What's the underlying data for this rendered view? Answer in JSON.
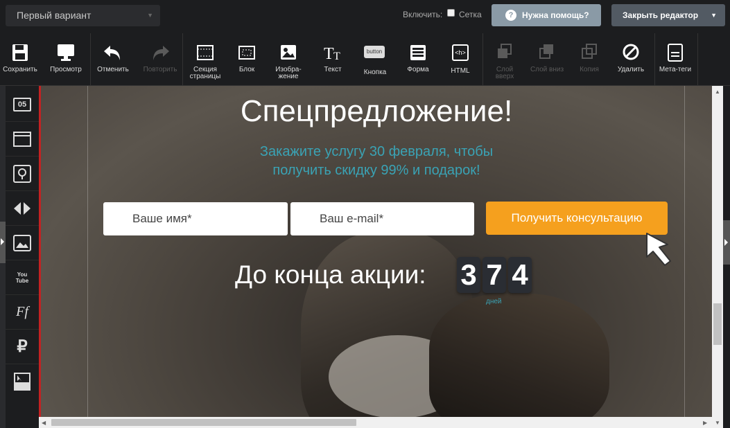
{
  "topbar": {
    "variant": "Первый вариант",
    "enable_label": "Включить:",
    "grid_label": "Сетка",
    "help_label": "Нужна помощь?",
    "close_label": "Закрыть редактор"
  },
  "toolbar": {
    "save": "Сохранить",
    "preview": "Просмотр",
    "undo": "Отменить",
    "redo": "Повторить",
    "section": "Секция страницы",
    "block": "Блок",
    "image": "Изобра-жение",
    "text": "Текст",
    "button": "Кнопка",
    "button_glyph": "button",
    "form": "Форма",
    "html": "HTML",
    "html_glyph": "<h>",
    "layer_up": "Слой вверх",
    "layer_down": "Слой вниз",
    "copy": "Копия",
    "delete": "Удалить",
    "meta": "Мета-теги"
  },
  "sidebar": {
    "timer_glyph": "05",
    "youtube_glyph": "You Tube",
    "ruble_glyph": "₽",
    "font_glyph": "Ff"
  },
  "page": {
    "headline": "Спецпредложение!",
    "subtitle_line1": "Закажите услугу 30 февраля, чтобы",
    "subtitle_line2": "получить скидку 99% и подарок!",
    "name_placeholder": "Ваше имя*",
    "email_placeholder": "Ваш e-mail*",
    "cta": "Получить консультацию",
    "countdown_label": "До конца акции:",
    "digits": [
      "3",
      "7",
      "4"
    ],
    "days_label": "дней"
  },
  "colors": {
    "accent": "#f5a01e",
    "teal": "#3aa3b5",
    "help_button": "#8a9aa6",
    "close_button": "#525a63",
    "selection_border": "#c32222"
  }
}
